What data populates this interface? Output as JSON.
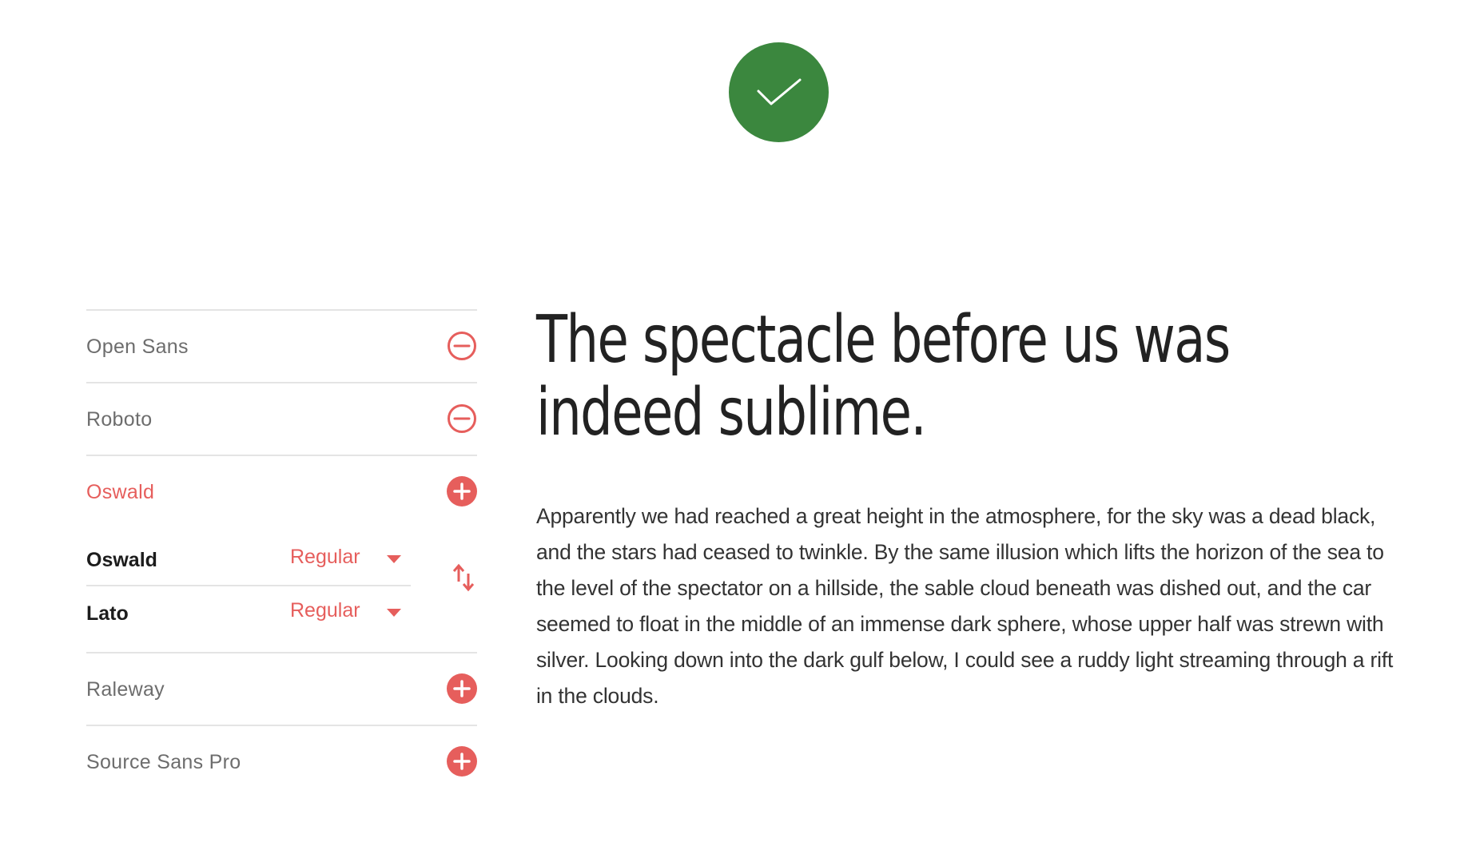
{
  "badge": {
    "icon": "check-icon",
    "color": "#3b873e"
  },
  "fonts": {
    "accent_color": "#e65e5c",
    "items": [
      {
        "label": "Open Sans",
        "action_icon": "minus-circle-icon"
      },
      {
        "label": "Roboto",
        "action_icon": "minus-circle-icon"
      },
      {
        "label": "Oswald",
        "action_icon": "plus-circle-icon"
      },
      {
        "label": "Raleway",
        "action_icon": "plus-circle-icon"
      },
      {
        "label": "Source Sans Pro",
        "action_icon": "plus-circle-icon"
      }
    ],
    "pairing": {
      "heading_font": "Oswald",
      "heading_weight": "Regular",
      "body_font": "Lato",
      "body_weight": "Regular",
      "swap_icon": "swap-vertical-icon"
    }
  },
  "preview": {
    "heading": "The spectacle before us was indeed sublime.",
    "body": "Apparently we had reached a great height in the atmosphere, for the sky was a dead black, and the stars had ceased to twinkle. By the same illusion which lifts the horizon of the sea to the level of the spectator on a hillside, the sable cloud beneath was dished out, and the car seemed to float in the middle of an immense dark sphere, whose upper half was strewn with silver. Looking down into the dark gulf below, I could see a ruddy light streaming through a rift in the clouds."
  }
}
